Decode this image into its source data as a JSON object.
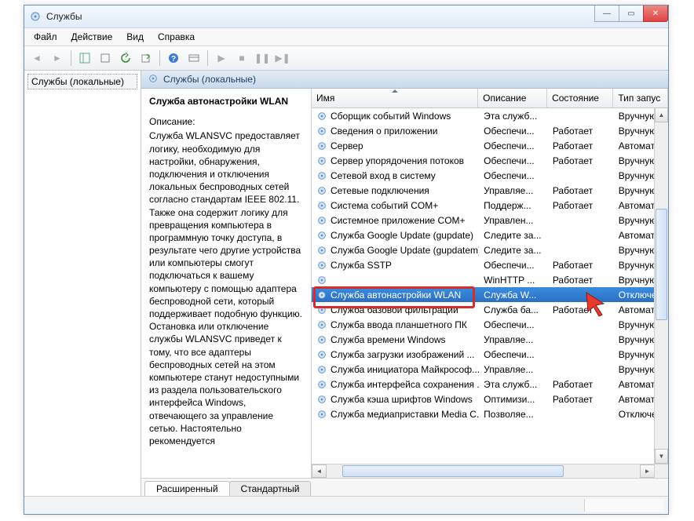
{
  "title": "Службы",
  "menu": {
    "file": "Файл",
    "action": "Действие",
    "view": "Вид",
    "help": "Справка"
  },
  "tree": {
    "root": "Службы (локальные)"
  },
  "header": {
    "label": "Службы (локальные)"
  },
  "detail": {
    "title": "Служба автонастройки WLAN",
    "desc_label": "Описание:",
    "desc_body": "Служба WLANSVC предоставляет логику, необходимую для настройки, обнаружения, подключения и отключения локальных беспроводных сетей согласно стандартам IEEE 802.11. Также она содержит логику для превращения компьютера в программную точку доступа, в результате чего другие устройства или компьютеры смогут подключаться к вашему компьютеру с помощью адаптера беспроводной сети, который поддерживает подобную функцию. Остановка или отключение службы WLANSVC приведет к тому, что все адаптеры беспроводных сетей на этом компьютере станут недоступными из раздела пользовательского интерфейса Windows, отвечающего за управление сетью. Настоятельно рекомендуется"
  },
  "columns": {
    "name": "Имя",
    "description": "Описание",
    "status": "Состояние",
    "startup": "Тип запус"
  },
  "services": [
    {
      "name": "Сборщик событий Windows",
      "desc": "Эта служб...",
      "status": "",
      "startup": "Вручную"
    },
    {
      "name": "Сведения о приложении",
      "desc": "Обеспечи...",
      "status": "Работает",
      "startup": "Вручную"
    },
    {
      "name": "Сервер",
      "desc": "Обеспечи...",
      "status": "Работает",
      "startup": "Автомати"
    },
    {
      "name": "Сервер упорядочения потоков",
      "desc": "Обеспечи...",
      "status": "Работает",
      "startup": "Вручную"
    },
    {
      "name": "Сетевой вход в систему",
      "desc": "Обеспечи...",
      "status": "",
      "startup": "Вручную"
    },
    {
      "name": "Сетевые подключения",
      "desc": "Управляе...",
      "status": "Работает",
      "startup": "Вручную"
    },
    {
      "name": "Система событий COM+",
      "desc": "Поддерж...",
      "status": "Работает",
      "startup": "Автомати"
    },
    {
      "name": "Системное приложение COM+",
      "desc": "Управлен...",
      "status": "",
      "startup": "Вручную"
    },
    {
      "name": "Служба Google Update (gupdate)",
      "desc": "Следите за...",
      "status": "",
      "startup": "Автомати"
    },
    {
      "name": "Служба Google Update (gupdatem)",
      "desc": "Следите за...",
      "status": "",
      "startup": "Вручную"
    },
    {
      "name": "Служба SSTP",
      "desc": "Обеспечи...",
      "status": "Работает",
      "startup": "Вручную"
    },
    {
      "name": "",
      "desc": "WinHTTP ...",
      "status": "Работает",
      "startup": "Вручную"
    },
    {
      "name": "Служба автонастройки WLAN",
      "desc": "Служба W...",
      "status": "",
      "startup": "Отключен",
      "selected": true
    },
    {
      "name": "Служба базовой фильтрации",
      "desc": "Служба ба...",
      "status": "Работает",
      "startup": "Автомати"
    },
    {
      "name": "Служба ввода планшетного ПК",
      "desc": "Обеспечи...",
      "status": "",
      "startup": "Вручную"
    },
    {
      "name": "Служба времени Windows",
      "desc": "Управляе...",
      "status": "",
      "startup": "Вручную"
    },
    {
      "name": "Служба загрузки изображений ...",
      "desc": "Обеспечи...",
      "status": "",
      "startup": "Вручную"
    },
    {
      "name": "Служба инициатора Майкрософ...",
      "desc": "Управляе...",
      "status": "",
      "startup": "Вручную"
    },
    {
      "name": "Служба интерфейса сохранения ...",
      "desc": "Эта служб...",
      "status": "Работает",
      "startup": "Автомати"
    },
    {
      "name": "Служба кэша шрифтов Windows",
      "desc": "Оптимизи...",
      "status": "Работает",
      "startup": "Автомати"
    },
    {
      "name": "Служба медиаприставки Media C...",
      "desc": "Позволяе...",
      "status": "",
      "startup": "Отключен"
    }
  ],
  "tabs": {
    "extended": "Расширенный",
    "standard": "Стандартный"
  },
  "col_widths": {
    "name": 218,
    "desc": 82,
    "status": 78,
    "startup": 62
  }
}
